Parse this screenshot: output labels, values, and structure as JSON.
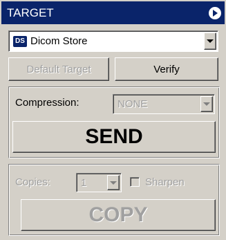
{
  "title": "TARGET",
  "title_button_icon": "circle-arrow-right-icon",
  "target_combo": {
    "icon_label": "DS",
    "value": "Dicom Store"
  },
  "buttons": {
    "default_target": "Default Target",
    "verify": "Verify",
    "send": "SEND",
    "copy": "COPY"
  },
  "compression": {
    "label": "Compression:",
    "value": "NONE"
  },
  "copies": {
    "label": "Copies:",
    "value": "1"
  },
  "sharpen": {
    "label": "Sharpen",
    "checked": false
  },
  "colors": {
    "titlebar": "#0a246a",
    "face": "#d4d0c8",
    "disabled_text": "#a0a0a0"
  }
}
